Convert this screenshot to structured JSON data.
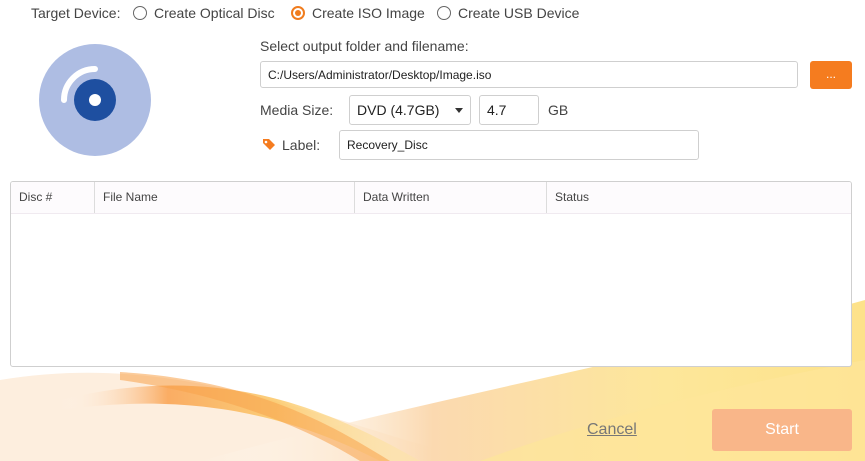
{
  "target_device": {
    "label": "Target Device:",
    "options": [
      {
        "label": "Create Optical Disc",
        "checked": false
      },
      {
        "label": "Create ISO Image",
        "checked": true
      },
      {
        "label": "Create USB Device",
        "checked": false
      }
    ]
  },
  "output": {
    "label": "Select output folder and filename:",
    "path": "C:/Users/Administrator/Desktop/Image.iso",
    "browse_label": "..."
  },
  "media": {
    "label": "Media Size:",
    "selected": "DVD (4.7GB)",
    "size_value": "4.7",
    "unit": "GB"
  },
  "disc_label": {
    "label": "Label:",
    "value": "Recovery_Disc"
  },
  "table": {
    "columns": [
      "Disc #",
      "File Name",
      "Data Written",
      "Status"
    ],
    "rows": []
  },
  "actions": {
    "cancel": "Cancel",
    "start": "Start"
  },
  "colors": {
    "accent": "#f57c1f",
    "disc_light": "#aebde3",
    "disc_dark": "#1e4fa0",
    "start_disabled": "#f9b689"
  },
  "icons": {
    "disc": "disc-icon",
    "tag": "tag-icon",
    "dropdown": "chevron-down-icon"
  }
}
